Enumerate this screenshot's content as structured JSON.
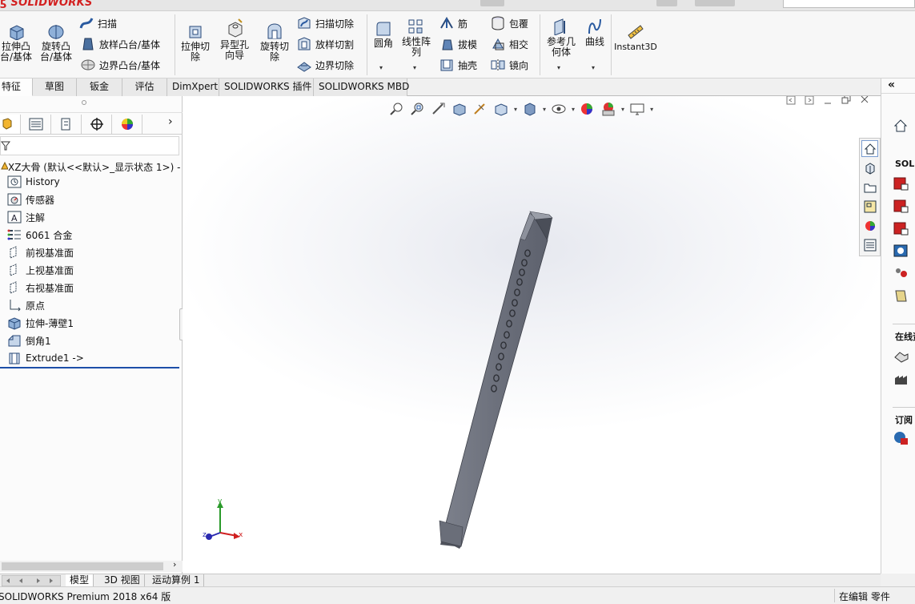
{
  "app": {
    "brand": "SOLIDWORKS"
  },
  "ribbon": {
    "extrude_boss": "拉伸凸\n台/基体",
    "revolve_boss": "旋转凸\n台/基体",
    "sweep": "扫描",
    "loft_boss": "放样凸台/基体",
    "boundary_boss": "边界凸台/基体",
    "extruded_cut": "拉伸切\n除",
    "hole_wizard": "异型孔\n向导",
    "revolved_cut": "旋转切\n除",
    "swept_cut": "扫描切除",
    "lofted_cut": "放样切割",
    "boundary_cut": "边界切除",
    "fillet": "圆角",
    "linear_pattern": "线性阵\n列",
    "rib": "筋",
    "draft": "拔模",
    "shell": "抽壳",
    "wrap": "包覆",
    "intersect": "相交",
    "mirror": "镜向",
    "ref_geometry": "参考几\n何体",
    "curves": "曲线",
    "instant3d": "Instant3D"
  },
  "command_tabs": [
    "特征",
    "草图",
    "钣金",
    "评估",
    "DimXpert",
    "SOLIDWORKS 插件",
    "SOLIDWORKS MBD"
  ],
  "tree": {
    "root": "XZ大骨  (默认<<默认>_显示状态 1>) -",
    "items": [
      "History",
      "传感器",
      "注解",
      "6061 合金",
      "前视基准面",
      "上视基准面",
      "右视基准面",
      "原点",
      "拉伸-薄壁1",
      "倒角1",
      "Extrude1 ->"
    ]
  },
  "triad": {
    "x": "x",
    "y": "y",
    "z": "z"
  },
  "taskpane": {
    "section1": "SOLID",
    "section2": "在线资",
    "section3": "订阅"
  },
  "bottom_tabs": [
    "模型",
    "3D 视图",
    "运动算例 1"
  ],
  "status": {
    "left": "SOLIDWORKS Premium 2018 x64 版",
    "right": "在编辑 零件"
  },
  "colors": {
    "brand_red": "#d32020",
    "part_gray": "#6d7280",
    "selection_blue": "#1d4fa8"
  }
}
